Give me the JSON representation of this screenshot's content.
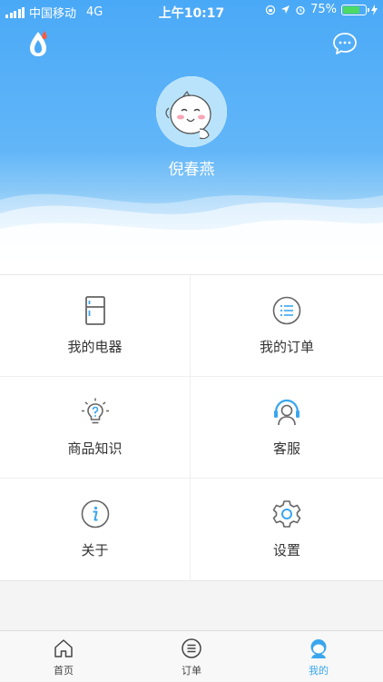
{
  "status_bar": {
    "carrier": "中国移动",
    "network": "4G",
    "time": "上午10:17",
    "battery": "75%",
    "battery_level": 0.75
  },
  "header": {
    "username": "倪春燕",
    "logo_icon": "water-drop-icon",
    "chat_icon": "chat-bubble-icon"
  },
  "menu": {
    "items": [
      {
        "label": "我的电器",
        "icon": "fridge-icon"
      },
      {
        "label": "我的订单",
        "icon": "list-icon"
      },
      {
        "label": "商品知识",
        "icon": "lightbulb-question-icon"
      },
      {
        "label": "客服",
        "icon": "headset-icon"
      },
      {
        "label": "关于",
        "icon": "info-icon"
      },
      {
        "label": "设置",
        "icon": "gear-icon"
      }
    ]
  },
  "tabbar": {
    "tabs": [
      {
        "label": "首页",
        "icon": "home-icon"
      },
      {
        "label": "订单",
        "icon": "list-icon"
      },
      {
        "label": "我的",
        "icon": "user-icon"
      }
    ],
    "active_index": 2
  },
  "colors": {
    "primary": "#4aa9f7",
    "active_tab": "#3aa6ee",
    "icon_gray": "#666666",
    "icon_accent": "#3aa6ee"
  }
}
